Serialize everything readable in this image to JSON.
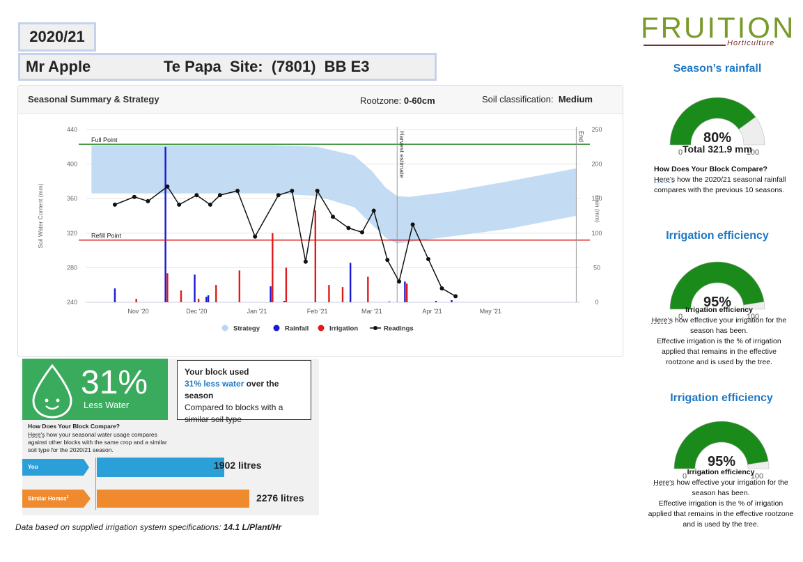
{
  "header": {
    "year": "2020/21",
    "owner": "Mr Apple",
    "site_label": "Te Papa  Site:  (7801)  BB E3"
  },
  "brand": {
    "name": "FRUITION",
    "sub": "Horticulture"
  },
  "card": {
    "title": "Seasonal Summary & Strategy",
    "rootzone_label": "Rootzone: ",
    "rootzone_value": "0-60cm",
    "soil_label": "Soil classification:",
    "soil_value": "Medium"
  },
  "chart_data": {
    "type": "line",
    "ylabel": "Soil Water Content (mm)",
    "y2label": "Rain (mm)",
    "ylim": [
      240,
      440
    ],
    "y_ticks": [
      240,
      280,
      320,
      360,
      400,
      440
    ],
    "y2lim": [
      0,
      250
    ],
    "y2_ticks": [
      0,
      50,
      100,
      150,
      200,
      250
    ],
    "x_ticks": [
      {
        "date": "2020-11-01",
        "label": "Nov '20"
      },
      {
        "date": "2020-12-01",
        "label": "Dec '20"
      },
      {
        "date": "2021-01-01",
        "label": "Jan '21"
      },
      {
        "date": "2021-02-01",
        "label": "Feb '21"
      },
      {
        "date": "2021-03-01",
        "label": "Mar '21"
      },
      {
        "date": "2021-04-01",
        "label": "Apr '21"
      },
      {
        "date": "2021-05-01",
        "label": "May '21"
      }
    ],
    "xlim": [
      "2020-10-05",
      "2021-06-16"
    ],
    "full_point": {
      "value": 423,
      "label": "Full Point",
      "color": "#2e8b2e"
    },
    "refill_point": {
      "value": 312,
      "label": "Refill Point",
      "color": "#e02020"
    },
    "vlines": [
      {
        "date": "2021-03-14",
        "label": "Harvest estimate"
      },
      {
        "date": "2021-06-14",
        "label": "End"
      }
    ],
    "strategy": {
      "name": "Strategy",
      "color": "#b9d6f2",
      "dates": [
        "2020-10-08",
        "2020-11-20",
        "2021-01-10",
        "2021-02-01",
        "2021-02-20",
        "2021-03-01",
        "2021-03-08",
        "2021-03-14",
        "2021-03-20",
        "2021-04-10",
        "2021-05-10",
        "2021-06-14"
      ],
      "upper": [
        422,
        422,
        422,
        420,
        410,
        392,
        373,
        363,
        362,
        368,
        380,
        395
      ],
      "lower": [
        366,
        366,
        366,
        363,
        350,
        330,
        315,
        308,
        310,
        316,
        325,
        340
      ]
    },
    "readings": {
      "name": "Readings",
      "color": "#111111",
      "dates": [
        "2020-10-20",
        "2020-10-30",
        "2020-11-06",
        "2020-11-16",
        "2020-11-22",
        "2020-12-01",
        "2020-12-08",
        "2020-12-13",
        "2020-12-22",
        "2020-12-31",
        "2021-01-12",
        "2021-01-19",
        "2021-01-26",
        "2021-02-01",
        "2021-02-09",
        "2021-02-17",
        "2021-02-24",
        "2021-03-02",
        "2021-03-09",
        "2021-03-15",
        "2021-03-22",
        "2021-03-30",
        "2021-04-06",
        "2021-04-13"
      ],
      "values": [
        353,
        362,
        357,
        374,
        353,
        364,
        353,
        364,
        369,
        316,
        364,
        369,
        287,
        369,
        339,
        326,
        321,
        346,
        289,
        264,
        330,
        290,
        256,
        247
      ]
    },
    "rainfall": {
      "name": "Rainfall",
      "color": "#1a1ad6",
      "bars": [
        {
          "date": "2020-10-20",
          "value": 20
        },
        {
          "date": "2020-11-15",
          "value": 225
        },
        {
          "date": "2020-11-30",
          "value": 40
        },
        {
          "date": "2020-12-06",
          "value": 8
        },
        {
          "date": "2020-12-07",
          "value": 10
        },
        {
          "date": "2021-01-08",
          "value": 23
        },
        {
          "date": "2021-01-15",
          "value": 2
        },
        {
          "date": "2021-02-18",
          "value": 57
        },
        {
          "date": "2021-03-10",
          "value": 1
        },
        {
          "date": "2021-03-18",
          "value": 30
        },
        {
          "date": "2021-04-03",
          "value": 2
        },
        {
          "date": "2021-04-11",
          "value": 3
        }
      ]
    },
    "irrigation": {
      "name": "Irrigation",
      "color": "#e01a1a",
      "bars": [
        {
          "date": "2020-10-31",
          "value": 5
        },
        {
          "date": "2020-11-16",
          "value": 42
        },
        {
          "date": "2020-11-23",
          "value": 17
        },
        {
          "date": "2020-12-02",
          "value": 5
        },
        {
          "date": "2020-12-11",
          "value": 25
        },
        {
          "date": "2020-12-23",
          "value": 46
        },
        {
          "date": "2021-01-09",
          "value": 100
        },
        {
          "date": "2021-01-16",
          "value": 50
        },
        {
          "date": "2021-01-31",
          "value": 133
        },
        {
          "date": "2021-02-07",
          "value": 25
        },
        {
          "date": "2021-02-14",
          "value": 22
        },
        {
          "date": "2021-02-27",
          "value": 37
        },
        {
          "date": "2021-03-19",
          "value": 27
        }
      ]
    },
    "legend": [
      "Strategy",
      "Rainfall",
      "Irrigation",
      "Readings"
    ],
    "legend_position": "bottom"
  },
  "usage": {
    "percent": "31%",
    "caption": "Less Water",
    "callout_title": "Your block used",
    "callout_highlight": "31% less water",
    "callout_rest": " over the season",
    "callout_line3": "Compared to blocks with a similar soil type",
    "compare_title": "How Does Your Block Compare?",
    "compare_link": "Here's",
    "compare_text": " how your seasonal water usage compares against other blocks with the same crop and a similar soil type for the 2020/21 season.",
    "bars": [
      {
        "label": "You",
        "value": 1902,
        "value_text": "1902 litres",
        "color": "#2a9fd8"
      },
      {
        "label": "Similar Homes",
        "sup": "1",
        "value": 2276,
        "value_text": "2276 litres",
        "color": "#ef8a2f"
      }
    ],
    "footnote_italic": "Data based on supplied irrigation system specifications: ",
    "footnote_bold": "14.1 L/Plant/Hr"
  },
  "gauges": [
    {
      "title": "Season’s rainfall",
      "percent": 80,
      "value_text": "80%",
      "min": "0",
      "max": "100",
      "total_label": "Total 321.9",
      "total_unit": " mm",
      "subtitle": "How Does Your Block Compare?",
      "link": "Here’s",
      "text": " how the 2020/21 seasonal rainfall compares with the previous 10 seasons.",
      "fill_color": "#1a8a1a"
    },
    {
      "title": "Irrigation efficiency",
      "percent": 95,
      "value_text": "95%",
      "min": "0",
      "max": "100",
      "subtitle": "Irrigation efficiency",
      "link": "Here’s",
      "text": " how effective your irrigation for the season has been.",
      "text2": "Effective irrigation is the % of irrigation applied that remains in the effective rootzone and is used by the tree.",
      "fill_color": "#1a8a1a"
    },
    {
      "title": "Irrigation efficiency",
      "percent": 95,
      "value_text": "95%",
      "min": "0",
      "max": "100",
      "subtitle": "Irrigation efficiency",
      "link": "Here’s",
      "text": " how effective your irrigation for the season has been.",
      "text2": "Effective irrigation is the % of irrigation applied that remains in the effective rootzone and is used by the tree.",
      "fill_color": "#1a8a1a"
    }
  ]
}
